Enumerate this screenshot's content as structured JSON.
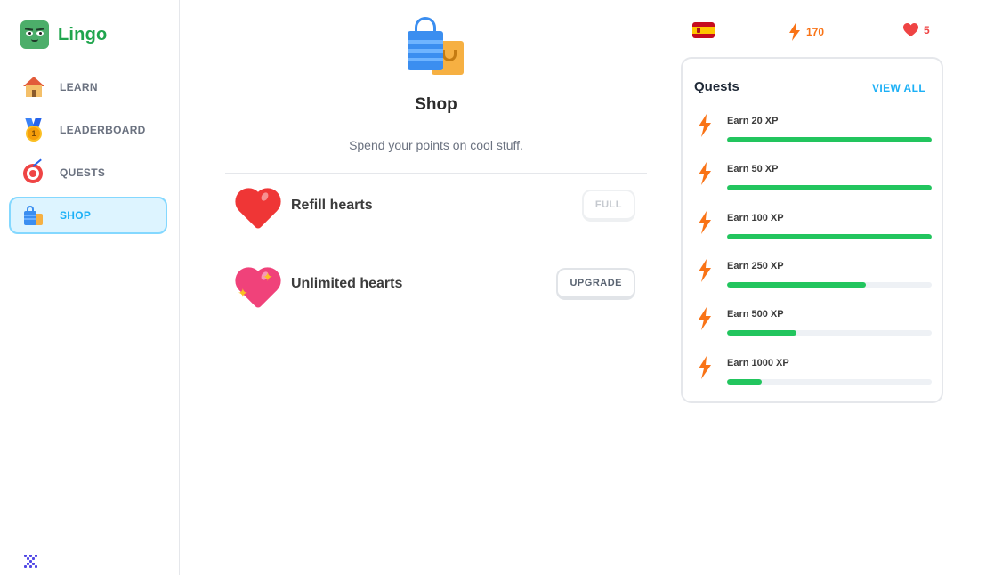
{
  "app": {
    "name": "Lingo"
  },
  "sidebar": {
    "items": [
      {
        "label": "LEARN",
        "icon": "house-icon",
        "active": false
      },
      {
        "label": "LEADERBOARD",
        "icon": "medal-icon",
        "active": false
      },
      {
        "label": "QUESTS",
        "icon": "target-icon",
        "active": false
      },
      {
        "label": "SHOP",
        "icon": "shopping-bag-icon",
        "active": true
      }
    ],
    "footer_icon": "grid-menu-icon"
  },
  "main": {
    "title": "Shop",
    "subtitle": "Spend your points on cool stuff.",
    "items": [
      {
        "title": "Refill hearts",
        "icon": "heart-icon",
        "button": "FULL",
        "button_disabled": true
      },
      {
        "title": "Unlimited hearts",
        "icon": "sparkling-heart-icon",
        "button": "UPGRADE",
        "button_disabled": false
      }
    ]
  },
  "stats": {
    "course_flag": "spain-flag-icon",
    "xp": "170",
    "hearts": "5"
  },
  "quests": {
    "title": "Quests",
    "view_all": "VIEW ALL",
    "items": [
      {
        "label": "Earn 20 XP",
        "progress": 1.0
      },
      {
        "label": "Earn 50 XP",
        "progress": 1.0
      },
      {
        "label": "Earn 100 XP",
        "progress": 1.0
      },
      {
        "label": "Earn 250 XP",
        "progress": 0.68
      },
      {
        "label": "Earn 500 XP",
        "progress": 0.34
      },
      {
        "label": "Earn 1000 XP",
        "progress": 0.17
      }
    ]
  },
  "colors": {
    "brand": "#1fa54d",
    "accent": "#1cb0f6",
    "progress": "#22c55e",
    "xp": "#f97316",
    "hearts": "#ef4444"
  }
}
